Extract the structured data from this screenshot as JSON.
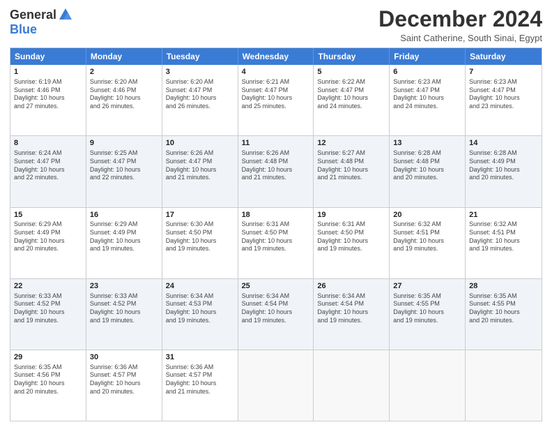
{
  "header": {
    "logo_general": "General",
    "logo_blue": "Blue",
    "month_title": "December 2024",
    "location": "Saint Catherine, South Sinai, Egypt"
  },
  "days_of_week": [
    "Sunday",
    "Monday",
    "Tuesday",
    "Wednesday",
    "Thursday",
    "Friday",
    "Saturday"
  ],
  "weeks": [
    [
      {
        "day": "1",
        "detail": "Sunrise: 6:19 AM\nSunset: 4:46 PM\nDaylight: 10 hours\nand 27 minutes."
      },
      {
        "day": "2",
        "detail": "Sunrise: 6:20 AM\nSunset: 4:46 PM\nDaylight: 10 hours\nand 26 minutes."
      },
      {
        "day": "3",
        "detail": "Sunrise: 6:20 AM\nSunset: 4:47 PM\nDaylight: 10 hours\nand 26 minutes."
      },
      {
        "day": "4",
        "detail": "Sunrise: 6:21 AM\nSunset: 4:47 PM\nDaylight: 10 hours\nand 25 minutes."
      },
      {
        "day": "5",
        "detail": "Sunrise: 6:22 AM\nSunset: 4:47 PM\nDaylight: 10 hours\nand 24 minutes."
      },
      {
        "day": "6",
        "detail": "Sunrise: 6:23 AM\nSunset: 4:47 PM\nDaylight: 10 hours\nand 24 minutes."
      },
      {
        "day": "7",
        "detail": "Sunrise: 6:23 AM\nSunset: 4:47 PM\nDaylight: 10 hours\nand 23 minutes."
      }
    ],
    [
      {
        "day": "8",
        "detail": "Sunrise: 6:24 AM\nSunset: 4:47 PM\nDaylight: 10 hours\nand 22 minutes."
      },
      {
        "day": "9",
        "detail": "Sunrise: 6:25 AM\nSunset: 4:47 PM\nDaylight: 10 hours\nand 22 minutes."
      },
      {
        "day": "10",
        "detail": "Sunrise: 6:26 AM\nSunset: 4:47 PM\nDaylight: 10 hours\nand 21 minutes."
      },
      {
        "day": "11",
        "detail": "Sunrise: 6:26 AM\nSunset: 4:48 PM\nDaylight: 10 hours\nand 21 minutes."
      },
      {
        "day": "12",
        "detail": "Sunrise: 6:27 AM\nSunset: 4:48 PM\nDaylight: 10 hours\nand 21 minutes."
      },
      {
        "day": "13",
        "detail": "Sunrise: 6:28 AM\nSunset: 4:48 PM\nDaylight: 10 hours\nand 20 minutes."
      },
      {
        "day": "14",
        "detail": "Sunrise: 6:28 AM\nSunset: 4:49 PM\nDaylight: 10 hours\nand 20 minutes."
      }
    ],
    [
      {
        "day": "15",
        "detail": "Sunrise: 6:29 AM\nSunset: 4:49 PM\nDaylight: 10 hours\nand 20 minutes."
      },
      {
        "day": "16",
        "detail": "Sunrise: 6:29 AM\nSunset: 4:49 PM\nDaylight: 10 hours\nand 19 minutes."
      },
      {
        "day": "17",
        "detail": "Sunrise: 6:30 AM\nSunset: 4:50 PM\nDaylight: 10 hours\nand 19 minutes."
      },
      {
        "day": "18",
        "detail": "Sunrise: 6:31 AM\nSunset: 4:50 PM\nDaylight: 10 hours\nand 19 minutes."
      },
      {
        "day": "19",
        "detail": "Sunrise: 6:31 AM\nSunset: 4:50 PM\nDaylight: 10 hours\nand 19 minutes."
      },
      {
        "day": "20",
        "detail": "Sunrise: 6:32 AM\nSunset: 4:51 PM\nDaylight: 10 hours\nand 19 minutes."
      },
      {
        "day": "21",
        "detail": "Sunrise: 6:32 AM\nSunset: 4:51 PM\nDaylight: 10 hours\nand 19 minutes."
      }
    ],
    [
      {
        "day": "22",
        "detail": "Sunrise: 6:33 AM\nSunset: 4:52 PM\nDaylight: 10 hours\nand 19 minutes."
      },
      {
        "day": "23",
        "detail": "Sunrise: 6:33 AM\nSunset: 4:52 PM\nDaylight: 10 hours\nand 19 minutes."
      },
      {
        "day": "24",
        "detail": "Sunrise: 6:34 AM\nSunset: 4:53 PM\nDaylight: 10 hours\nand 19 minutes."
      },
      {
        "day": "25",
        "detail": "Sunrise: 6:34 AM\nSunset: 4:54 PM\nDaylight: 10 hours\nand 19 minutes."
      },
      {
        "day": "26",
        "detail": "Sunrise: 6:34 AM\nSunset: 4:54 PM\nDaylight: 10 hours\nand 19 minutes."
      },
      {
        "day": "27",
        "detail": "Sunrise: 6:35 AM\nSunset: 4:55 PM\nDaylight: 10 hours\nand 19 minutes."
      },
      {
        "day": "28",
        "detail": "Sunrise: 6:35 AM\nSunset: 4:55 PM\nDaylight: 10 hours\nand 20 minutes."
      }
    ],
    [
      {
        "day": "29",
        "detail": "Sunrise: 6:35 AM\nSunset: 4:56 PM\nDaylight: 10 hours\nand 20 minutes."
      },
      {
        "day": "30",
        "detail": "Sunrise: 6:36 AM\nSunset: 4:57 PM\nDaylight: 10 hours\nand 20 minutes."
      },
      {
        "day": "31",
        "detail": "Sunrise: 6:36 AM\nSunset: 4:57 PM\nDaylight: 10 hours\nand 21 minutes."
      },
      {
        "day": "",
        "detail": ""
      },
      {
        "day": "",
        "detail": ""
      },
      {
        "day": "",
        "detail": ""
      },
      {
        "day": "",
        "detail": ""
      }
    ]
  ]
}
